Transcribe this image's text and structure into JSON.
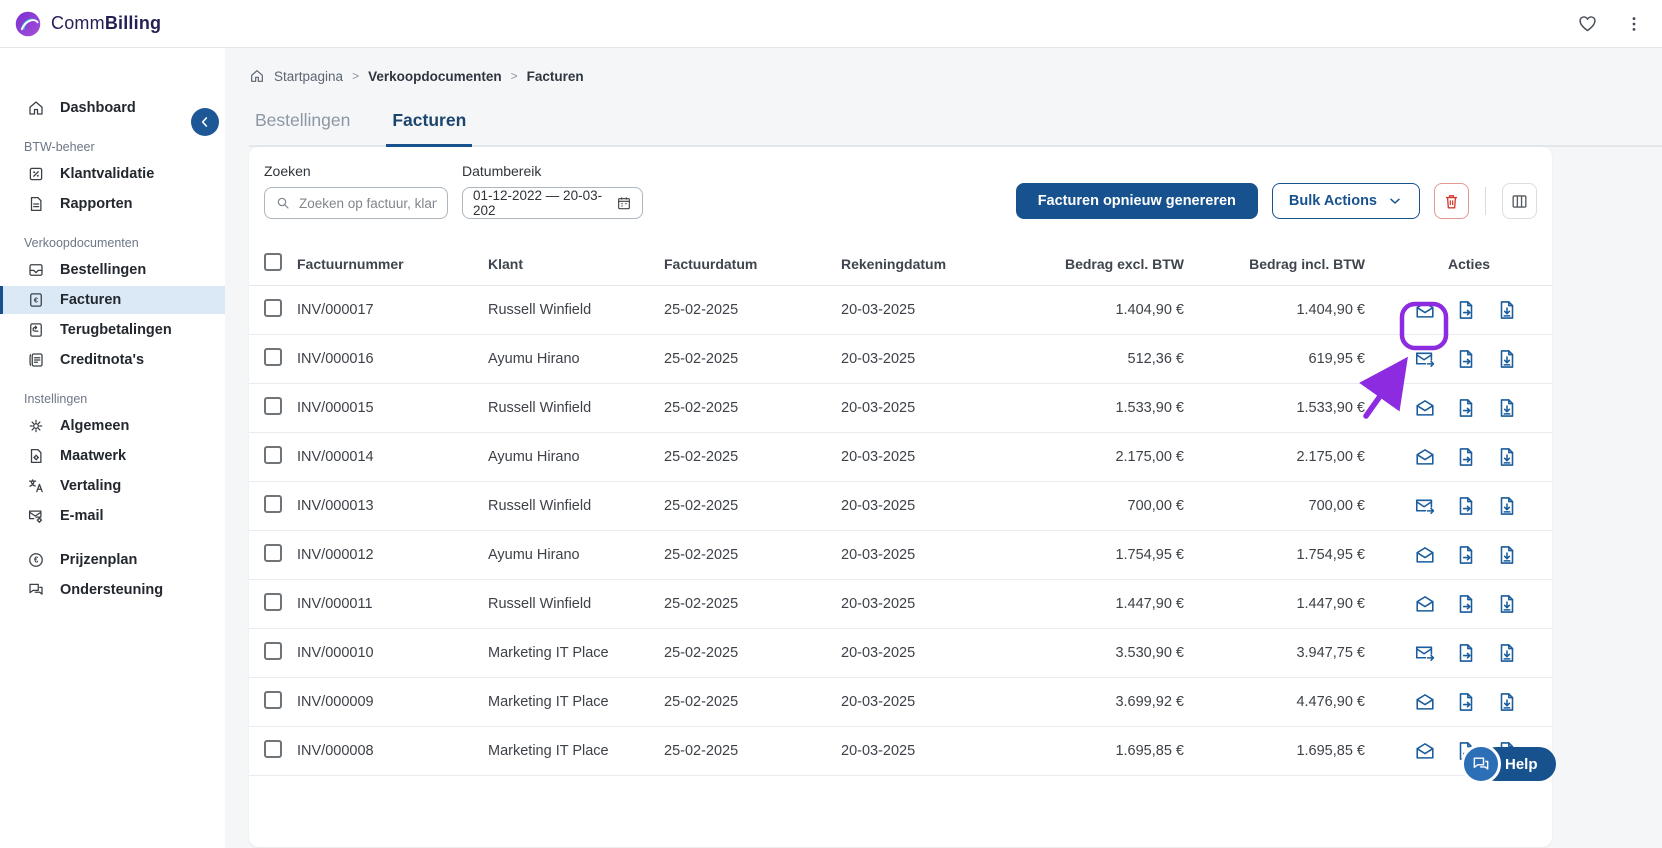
{
  "brand": {
    "name_regular": "Comm",
    "name_bold": "Billing",
    "logo_icon": "commbilling-logo-icon"
  },
  "topbar": {
    "icons": [
      "heart-icon",
      "kebab-menu-icon"
    ]
  },
  "sidebar": {
    "collapse_icon": "chevron-left-icon",
    "groups": [
      {
        "header": null,
        "items": [
          {
            "id": "dashboard",
            "label": "Dashboard",
            "icon": "home-icon"
          }
        ]
      },
      {
        "header": "BTW-beheer",
        "items": [
          {
            "id": "klantvalidatie",
            "label": "Klantvalidatie",
            "icon": "validation-percent-icon"
          },
          {
            "id": "rapporten",
            "label": "Rapporten",
            "icon": "report-icon"
          }
        ]
      },
      {
        "header": "Verkoopdocumenten",
        "items": [
          {
            "id": "bestellingen",
            "label": "Bestellingen",
            "icon": "orders-icon"
          },
          {
            "id": "facturen",
            "label": "Facturen",
            "icon": "invoice-euro-icon",
            "active": true
          },
          {
            "id": "terugbetalingen",
            "label": "Terugbetalingen",
            "icon": "refund-icon"
          },
          {
            "id": "creditnotas",
            "label": "Creditnota's",
            "icon": "credit-note-icon"
          }
        ]
      },
      {
        "header": "Instellingen",
        "items": [
          {
            "id": "algemeen",
            "label": "Algemeen",
            "icon": "gear-icon"
          },
          {
            "id": "maatwerk",
            "label": "Maatwerk",
            "icon": "custom-doc-icon"
          },
          {
            "id": "vertaling",
            "label": "Vertaling",
            "icon": "translate-icon"
          },
          {
            "id": "email",
            "label": "E-mail",
            "icon": "mail-settings-icon"
          }
        ]
      },
      {
        "header": null,
        "gap": true,
        "items": [
          {
            "id": "prijzenplan",
            "label": "Prijzenplan",
            "icon": "pricing-euro-icon"
          },
          {
            "id": "ondersteuning",
            "label": "Ondersteuning",
            "icon": "support-chat-icon"
          }
        ]
      }
    ]
  },
  "breadcrumb": {
    "home_icon": "home-icon",
    "items": [
      "Startpagina",
      "Verkoopdocumenten",
      "Facturen"
    ]
  },
  "tabs": [
    {
      "label": "Bestellingen",
      "active": false
    },
    {
      "label": "Facturen",
      "active": true
    }
  ],
  "filters": {
    "search_label": "Zoeken",
    "search_placeholder": "Zoeken op factuur, klant,",
    "search_icon": "search-icon",
    "date_label": "Datumbereik",
    "date_value": "01-12-2022 — 20-03-202",
    "date_icon": "calendar-icon"
  },
  "toolbar": {
    "regenerate_label": "Facturen opnieuw genereren",
    "bulk_label": "Bulk Actions",
    "bulk_chevron_icon": "chevron-down-icon",
    "delete_icon": "trash-icon",
    "columns_icon": "columns-icon"
  },
  "table": {
    "columns": [
      "Factuurnummer",
      "Klant",
      "Factuurdatum",
      "Rekeningdatum",
      "Bedrag excl. BTW",
      "Bedrag incl. BTW",
      "Acties"
    ],
    "row_action_icons": [
      "file-export-icon",
      "file-download-icon"
    ],
    "rows": [
      {
        "invoice_number": "INV/000017",
        "client": "Russell Winfield",
        "invoice_date": "25-02-2025",
        "billing_date": "20-03-2025",
        "amount_excl": "1.404,90 €",
        "amount_incl": "1.404,90 €",
        "mail_icon": "mail-open-icon",
        "highlighted": true
      },
      {
        "invoice_number": "INV/000016",
        "client": "Ayumu Hirano",
        "invoice_date": "25-02-2025",
        "billing_date": "20-03-2025",
        "amount_excl": "512,36 €",
        "amount_incl": "619,95 €",
        "mail_icon": "mail-send-icon",
        "highlighted": false
      },
      {
        "invoice_number": "INV/000015",
        "client": "Russell Winfield",
        "invoice_date": "25-02-2025",
        "billing_date": "20-03-2025",
        "amount_excl": "1.533,90 €",
        "amount_incl": "1.533,90 €",
        "mail_icon": "mail-open-icon",
        "highlighted": false
      },
      {
        "invoice_number": "INV/000014",
        "client": "Ayumu Hirano",
        "invoice_date": "25-02-2025",
        "billing_date": "20-03-2025",
        "amount_excl": "2.175,00 €",
        "amount_incl": "2.175,00 €",
        "mail_icon": "mail-open-icon",
        "highlighted": false
      },
      {
        "invoice_number": "INV/000013",
        "client": "Russell Winfield",
        "invoice_date": "25-02-2025",
        "billing_date": "20-03-2025",
        "amount_excl": "700,00 €",
        "amount_incl": "700,00 €",
        "mail_icon": "mail-send-icon",
        "highlighted": false
      },
      {
        "invoice_number": "INV/000012",
        "client": "Ayumu Hirano",
        "invoice_date": "25-02-2025",
        "billing_date": "20-03-2025",
        "amount_excl": "1.754,95 €",
        "amount_incl": "1.754,95 €",
        "mail_icon": "mail-open-icon",
        "highlighted": false
      },
      {
        "invoice_number": "INV/000011",
        "client": "Russell Winfield",
        "invoice_date": "25-02-2025",
        "billing_date": "20-03-2025",
        "amount_excl": "1.447,90 €",
        "amount_incl": "1.447,90 €",
        "mail_icon": "mail-open-icon",
        "highlighted": false
      },
      {
        "invoice_number": "INV/000010",
        "client": "Marketing IT Place",
        "invoice_date": "25-02-2025",
        "billing_date": "20-03-2025",
        "amount_excl": "3.530,90 €",
        "amount_incl": "3.947,75 €",
        "mail_icon": "mail-send-icon",
        "highlighted": false
      },
      {
        "invoice_number": "INV/000009",
        "client": "Marketing IT Place",
        "invoice_date": "25-02-2025",
        "billing_date": "20-03-2025",
        "amount_excl": "3.699,92 €",
        "amount_incl": "4.476,90 €",
        "mail_icon": "mail-open-icon",
        "highlighted": false
      },
      {
        "invoice_number": "INV/000008",
        "client": "Marketing IT Place",
        "invoice_date": "25-02-2025",
        "billing_date": "20-03-2025",
        "amount_excl": "1.695,85 €",
        "amount_incl": "1.695,85 €",
        "mail_icon": "mail-open-icon",
        "highlighted": false
      }
    ]
  },
  "help": {
    "label": "Help",
    "chat_icon": "chat-bubbles-icon"
  },
  "annotation": {
    "type": "highlight-box-with-arrow",
    "color": "#8C2BE0",
    "target": "first-row mail-open icon"
  },
  "colors": {
    "primary": "#17528F",
    "action_icon_blue": "#1A5C9C",
    "danger": "#D23B2F",
    "active_item_bg": "#DBE9F7",
    "annotation": "#8C2BE0",
    "content_bg": "#F5F6F8"
  }
}
